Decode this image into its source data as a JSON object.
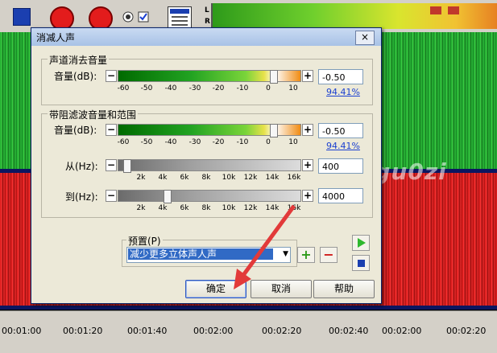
{
  "toolbar": {
    "meter_l": "L",
    "meter_r": "R"
  },
  "timeline": {
    "ticks": [
      "00:01:00",
      "00:01:20",
      "00:01:40",
      "00:02:00",
      "00:02:20",
      "00:02:40",
      "00:02:00",
      "00:02:20"
    ]
  },
  "dialog": {
    "title": "消减人声",
    "close_label": "×",
    "group1": {
      "title": "声道消去音量",
      "label": "音量(dB):",
      "value": "-0.50",
      "percent": "94.41%",
      "scale": [
        "-60",
        "-50",
        "-40",
        "-30",
        "-20",
        "-10",
        "0",
        "10"
      ]
    },
    "group2": {
      "title": "带阻滤波音量和范围",
      "label": "音量(dB):",
      "value": "-0.50",
      "percent": "94.41%",
      "scale": [
        "-60",
        "-50",
        "-40",
        "-30",
        "-20",
        "-10",
        "0",
        "10"
      ],
      "from_label": "从(Hz):",
      "from_value": "400",
      "to_label": "到(Hz):",
      "to_value": "4000",
      "freq_scale": [
        "2k",
        "4k",
        "6k",
        "8k",
        "10k",
        "12k",
        "14k",
        "16k"
      ]
    },
    "preset": {
      "label": "预置(P)",
      "selected": "减少更多立体声人声"
    },
    "buttons": {
      "ok": "确定",
      "cancel": "取消",
      "help": "帮助"
    },
    "minus_symbol": "−",
    "plus_symbol": "+"
  },
  "watermark": "百度ID gu0zi",
  "colors": {
    "accent": "#316ac5",
    "titlebar": "#b9cdeb",
    "wave_green": "#2cbc3b",
    "wave_red": "#e52a2a"
  }
}
